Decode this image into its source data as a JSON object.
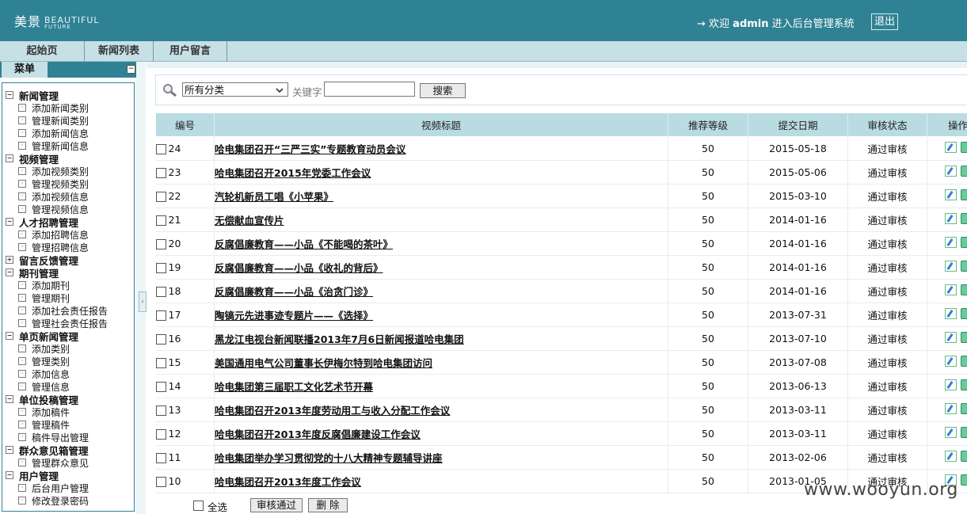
{
  "header": {
    "logo_cn": "美景",
    "logo_en_1": "BEAUTIFUL",
    "logo_en_2": "FUTURE",
    "welcome_prefix": "→ 欢迎 ",
    "user": "admin",
    "welcome_suffix": " 进入后台管理系统",
    "logout": "退出"
  },
  "nav": {
    "tabs": [
      "起始页",
      "新闻列表",
      "用户留言"
    ]
  },
  "sidebar": {
    "title": "菜单",
    "groups": [
      {
        "label": "新闻管理",
        "items": [
          "添加新闻类别",
          "管理新闻类别",
          "添加新闻信息",
          "管理新闻信息"
        ]
      },
      {
        "label": "视频管理",
        "items": [
          "添加视频类别",
          "管理视频类别",
          "添加视频信息",
          "管理视频信息"
        ]
      },
      {
        "label": "人才招聘管理",
        "items": [
          "添加招聘信息",
          "管理招聘信息"
        ]
      },
      {
        "label": "留言反馈管理",
        "items": []
      },
      {
        "label": "期刊管理",
        "items": [
          "添加期刊",
          "管理期刊",
          "添加社会责任报告",
          "管理社会责任报告"
        ]
      },
      {
        "label": "单页新闻管理",
        "items": [
          "添加类别",
          "管理类别",
          "添加信息",
          "管理信息"
        ]
      },
      {
        "label": "单位投稿管理",
        "items": [
          "添加稿件",
          "管理稿件",
          "稿件导出管理"
        ]
      },
      {
        "label": "群众意见箱管理",
        "items": [
          "管理群众意见"
        ]
      },
      {
        "label": "用户管理",
        "items": [
          "后台用户管理",
          "修改登录密码"
        ]
      }
    ]
  },
  "search": {
    "category_selected": "所有分类",
    "keyword_label": "关键字",
    "keyword_value": "",
    "button": "搜索"
  },
  "table": {
    "headers": [
      "编号",
      "视频标题",
      "推荐等级",
      "提交日期",
      "审核状态",
      "操作"
    ],
    "rows": [
      {
        "id": "24",
        "title": "哈电集团召开“三严三实”专题教育动员会议",
        "level": "50",
        "date": "2015-05-18",
        "status": "通过审核"
      },
      {
        "id": "23",
        "title": "哈电集团召开2015年党委工作会议",
        "level": "50",
        "date": "2015-05-06",
        "status": "通过审核"
      },
      {
        "id": "22",
        "title": "汽轮机新员工唱《小苹果》",
        "level": "50",
        "date": "2015-03-10",
        "status": "通过审核"
      },
      {
        "id": "21",
        "title": "无偿献血宣传片",
        "level": "50",
        "date": "2014-01-16",
        "status": "通过审核"
      },
      {
        "id": "20",
        "title": "反腐倡廉教育——小品《不能喝的茶叶》",
        "level": "50",
        "date": "2014-01-16",
        "status": "通过审核"
      },
      {
        "id": "19",
        "title": "反腐倡廉教育——小品《收礼的背后》",
        "level": "50",
        "date": "2014-01-16",
        "status": "通过审核"
      },
      {
        "id": "18",
        "title": "反腐倡廉教育——小品《治贪门诊》",
        "level": "50",
        "date": "2014-01-16",
        "status": "通过审核"
      },
      {
        "id": "17",
        "title": "陶镐元先进事迹专题片——《选择》",
        "level": "50",
        "date": "2013-07-31",
        "status": "通过审核"
      },
      {
        "id": "16",
        "title": "黑龙江电视台新闻联播2013年7月6日新闻报道哈电集团",
        "level": "50",
        "date": "2013-07-10",
        "status": "通过审核"
      },
      {
        "id": "15",
        "title": "美国通用电气公司董事长伊梅尔特到哈电集团访问",
        "level": "50",
        "date": "2013-07-08",
        "status": "通过审核"
      },
      {
        "id": "14",
        "title": "哈电集团第三届职工文化艺术节开幕",
        "level": "50",
        "date": "2013-06-13",
        "status": "通过审核"
      },
      {
        "id": "13",
        "title": "哈电集团召开2013年度劳动用工与收入分配工作会议",
        "level": "50",
        "date": "2013-03-11",
        "status": "通过审核"
      },
      {
        "id": "12",
        "title": "哈电集团召开2013年度反腐倡廉建设工作会议",
        "level": "50",
        "date": "2013-03-11",
        "status": "通过审核"
      },
      {
        "id": "11",
        "title": "哈电集团举办学习贯彻党的十八大精神专题辅导讲座",
        "level": "50",
        "date": "2013-02-06",
        "status": "通过审核"
      },
      {
        "id": "10",
        "title": "哈电集团召开2013年度工作会议",
        "level": "50",
        "date": "2013-01-05",
        "status": "通过审核"
      }
    ]
  },
  "footer": {
    "select_all": "全选",
    "approve": "审核通过",
    "delete": "删 除"
  },
  "watermark": "www.wooyun.org"
}
